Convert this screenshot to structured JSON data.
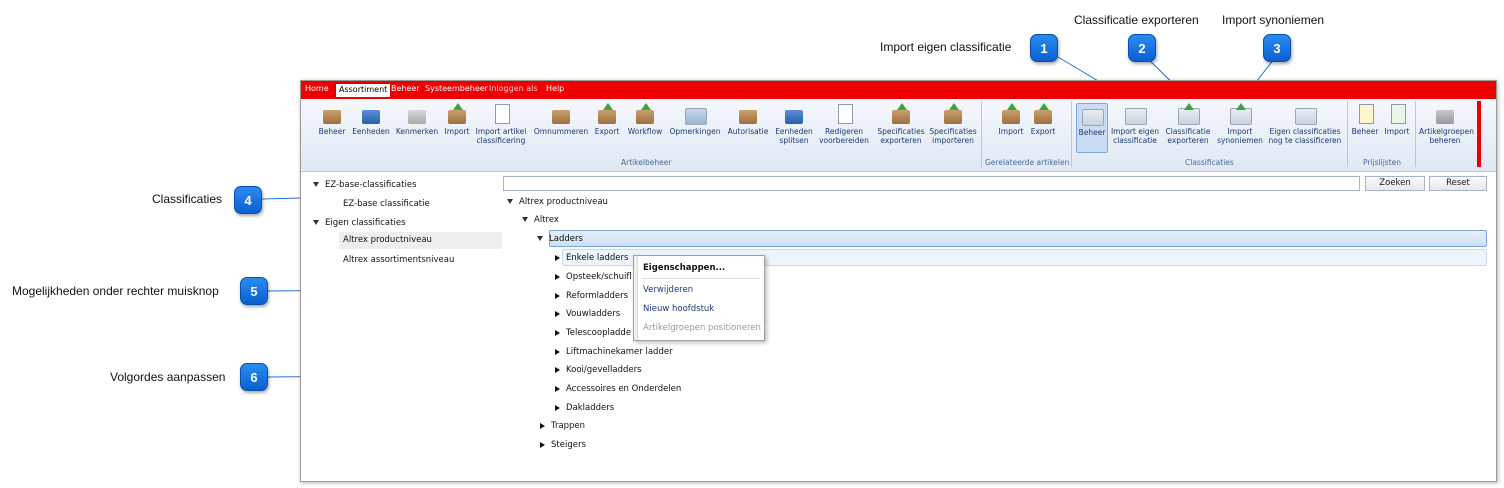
{
  "callouts": [
    {
      "label": "Import eigen classificatie",
      "number": "1"
    },
    {
      "label": "Classificatie exporteren",
      "number": "2"
    },
    {
      "label": "Import synoniemen",
      "number": "3"
    },
    {
      "label": "Classificaties",
      "number": "4"
    },
    {
      "label": "Mogelijkheden onder rechter muisknop",
      "number": "5"
    },
    {
      "label": "Volgordes aanpassen",
      "number": "6"
    }
  ],
  "menu": [
    "Home",
    "Assortiment",
    "Beheer",
    "Systeembeheer",
    "Inloggen als",
    "Help"
  ],
  "ribbon": {
    "buttons": [
      {
        "label": "Beheer",
        "icon": "box-icon"
      },
      {
        "label": "Eenheden",
        "icon": "truck-icon"
      },
      {
        "label": "Kenmerken",
        "icon": "tags-icon"
      },
      {
        "label": "Import",
        "icon": "import-box-icon"
      },
      {
        "label": "Import artikel classificering",
        "icon": "import-doc-icon"
      },
      {
        "label": "Omnummeren",
        "icon": "renumber-icon"
      },
      {
        "label": "Export",
        "icon": "export-box-icon"
      },
      {
        "label": "Workflow",
        "icon": "workflow-icon"
      },
      {
        "label": "Opmerkingen",
        "icon": "comment-icon"
      },
      {
        "label": "Autorisatie",
        "icon": "authorize-icon"
      },
      {
        "label": "Eenheden splitsen",
        "icon": "split-icon"
      },
      {
        "label": "Redigeren voorbereiden",
        "icon": "checklist-icon"
      },
      {
        "label": "Specificaties exporteren",
        "icon": "export-spec-icon"
      },
      {
        "label": "Specificaties importeren",
        "icon": "import-spec-icon"
      },
      {
        "label": "Import",
        "icon": "import-related-icon"
      },
      {
        "label": "Export",
        "icon": "export-related-icon"
      },
      {
        "label": "Beheer",
        "icon": "folder-icon"
      },
      {
        "label": "Import eigen classificatie",
        "icon": "folder-import-icon"
      },
      {
        "label": "Classificatie exporteren",
        "icon": "folder-export-icon"
      },
      {
        "label": "Import synoniemen",
        "icon": "folder-synonyms-icon"
      },
      {
        "label": "Eigen classificaties nog te classificeren",
        "icon": "folder-pending-icon"
      },
      {
        "label": "Beheer",
        "icon": "price-icon"
      },
      {
        "label": "Import",
        "icon": "price-import-icon"
      },
      {
        "label": "Artikelgroepen beheren",
        "icon": "groups-icon"
      }
    ],
    "groups": [
      "Artikelbeheer",
      "Gerelateerde artikelen",
      "Classificaties",
      "Prijslijsten"
    ]
  },
  "left_tree": [
    {
      "label": "EZ-base-classificaties"
    },
    {
      "label": "EZ-base classificatie"
    },
    {
      "label": "Eigen classificaties"
    },
    {
      "label": "Altrex productniveau"
    },
    {
      "label": "Altrex assortimentsniveau"
    }
  ],
  "search": {
    "value": "",
    "search_label": "Zoeken",
    "reset_label": "Reset"
  },
  "right_tree": [
    "Altrex productniveau",
    "Altrex",
    "Ladders",
    "Enkele ladders",
    "Opsteek/schuifladders",
    "Reformladders",
    "Vouwladders",
    "Telescoopladders",
    "Liftmachinekamer ladder",
    "Kooi/gevelladders",
    "Accessoires en Onderdelen",
    "Dakladders",
    "Trappen",
    "Steigers"
  ],
  "context_menu": [
    "Eigenschappen...",
    "Verwijderen",
    "Nieuw hoofdstuk",
    "Artikelgroepen positioneren"
  ]
}
